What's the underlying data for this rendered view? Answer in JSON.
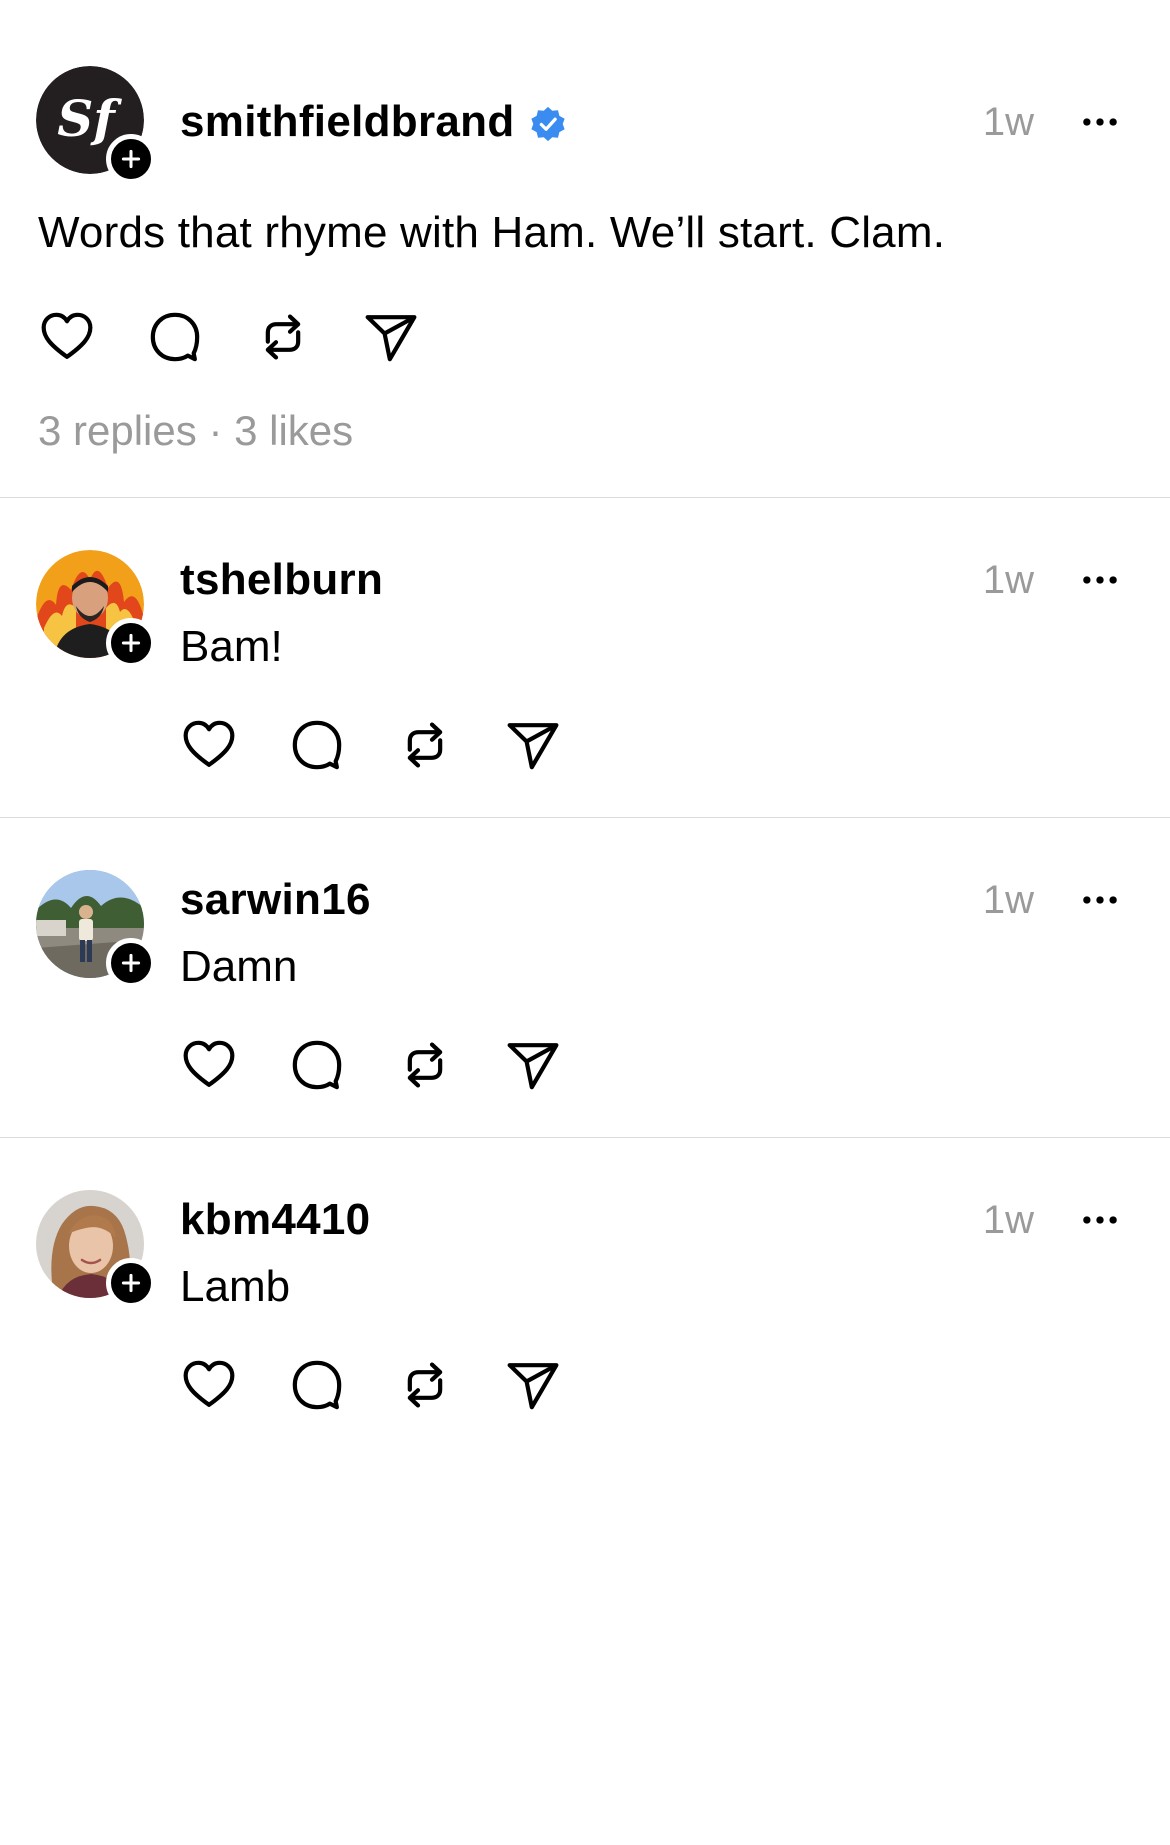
{
  "post": {
    "username": "smithfieldbrand",
    "avatar_text": "Sf",
    "time": "1w",
    "text": "Words that rhyme with Ham. We’ll start. Clam.",
    "replies_count": "3 replies",
    "separator": "·",
    "likes_count": "3 likes",
    "verified_color": "#3b8cf0"
  },
  "replies": [
    {
      "username": "tshelburn",
      "time": "1w",
      "text": "Bam!"
    },
    {
      "username": "sarwin16",
      "time": "1w",
      "text": "Damn"
    },
    {
      "username": "kbm4410",
      "time": "1w",
      "text": "Lamb"
    }
  ],
  "icons": {
    "like": "heart-icon",
    "reply": "comment-icon",
    "repost": "repost-icon",
    "share": "send-icon",
    "more": "more-icon",
    "follow": "plus-icon"
  }
}
